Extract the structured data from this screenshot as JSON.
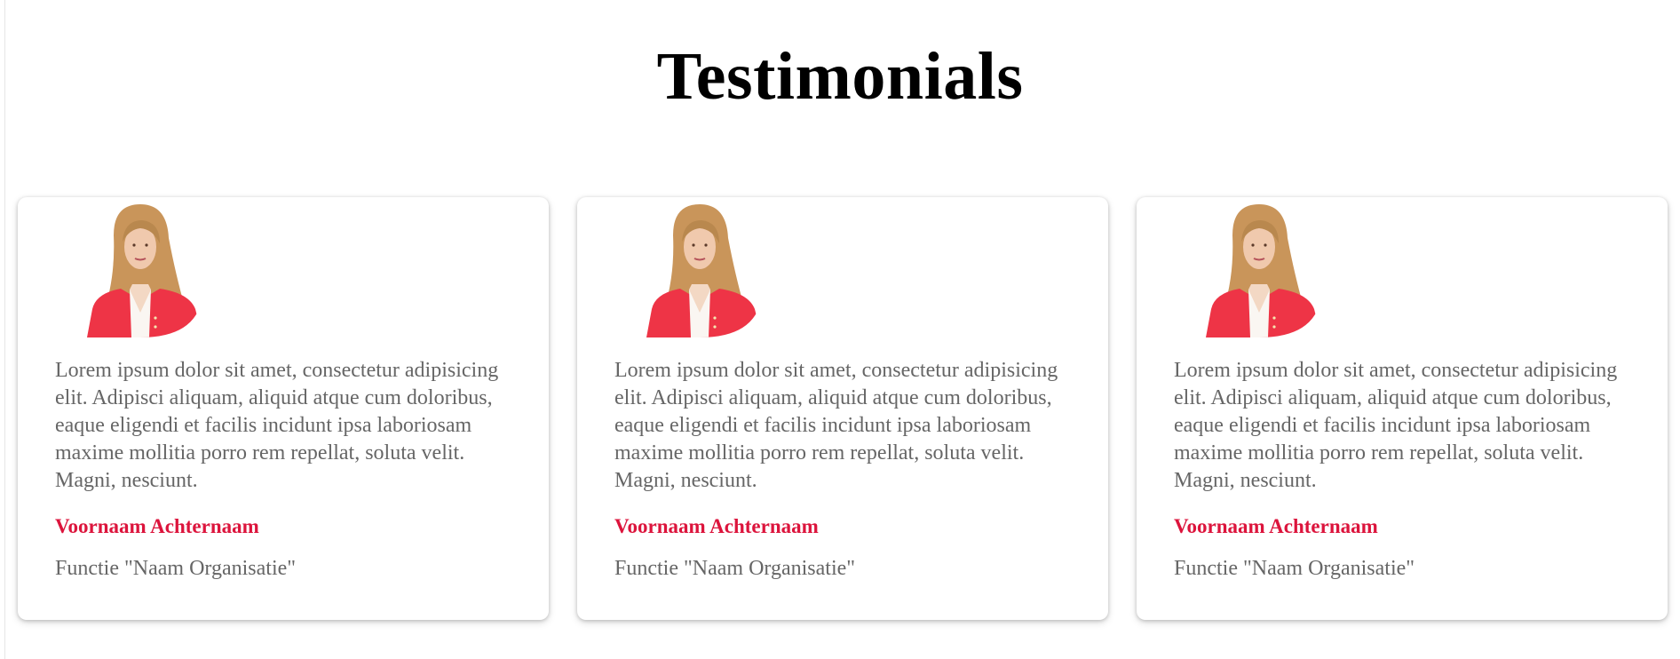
{
  "page": {
    "title": "Testimonials"
  },
  "colors": {
    "name_accent": "#dc143c",
    "body_text": "#666666",
    "jacket": "#ee3446"
  },
  "testimonials": [
    {
      "avatar_icon": "person-photo",
      "quote": "Lorem ipsum dolor sit amet, consectetur adipisicing elit. Adipisci aliquam, aliquid atque cum doloribus, eaque eligendi et facilis incidunt ipsa laboriosam maxime mollitia porro rem repellat, soluta velit. Magni, nesciunt.",
      "name": "Voornaam Achternaam",
      "role": "Functie \"Naam Organisatie\""
    },
    {
      "avatar_icon": "person-photo",
      "quote": "Lorem ipsum dolor sit amet, consectetur adipisicing elit. Adipisci aliquam, aliquid atque cum doloribus, eaque eligendi et facilis incidunt ipsa laboriosam maxime mollitia porro rem repellat, soluta velit. Magni, nesciunt.",
      "name": "Voornaam Achternaam",
      "role": "Functie \"Naam Organisatie\""
    },
    {
      "avatar_icon": "person-photo",
      "quote": "Lorem ipsum dolor sit amet, consectetur adipisicing elit. Adipisci aliquam, aliquid atque cum doloribus, eaque eligendi et facilis incidunt ipsa laboriosam maxime mollitia porro rem repellat, soluta velit. Magni, nesciunt.",
      "name": "Voornaam Achternaam",
      "role": "Functie \"Naam Organisatie\""
    }
  ]
}
